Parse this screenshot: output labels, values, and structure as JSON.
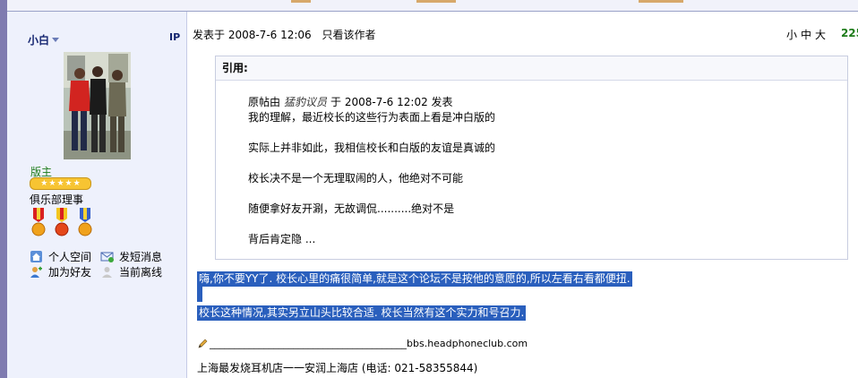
{
  "sidebar": {
    "username": "小白",
    "ip_label": "IP",
    "rank": "版主",
    "title": "俱乐部理事",
    "links": [
      {
        "label": "个人空间",
        "icon": "home-icon"
      },
      {
        "label": "发短消息",
        "icon": "message-icon"
      },
      {
        "label": "加为好友",
        "icon": "add-friend-icon"
      },
      {
        "label": "当前离线",
        "icon": "offline-user-icon"
      }
    ]
  },
  "post": {
    "meta": "发表于  2008-7-6 12:06",
    "author_only": "只看该作者",
    "font_sizes": "小中大",
    "floor": "225"
  },
  "quote": {
    "header": "引用:",
    "byline_prefix": "原帖由",
    "byline_name": "猛豹议员",
    "byline_suffix": "于  2008-7-6 12:02 发表",
    "lines": [
      "我的理解，最近校长的这些行为表面上看是冲白版的",
      "实际上并非如此，我相信校长和白版的友谊是真诚的",
      "校长决不是一个无理取闹的人，他绝对不可能",
      "随便拿好友开涮，无故调侃..........绝对不是",
      "背后肯定隐  ..."
    ]
  },
  "reply": {
    "line1": "嗨,你不要YY了. 校长心里的痛很简单,就是这个论坛不是按他的意愿的,所以左看右看都便扭.",
    "line2": "校长这种情况,其实另立山头比较合适. 校长当然有这个实力和号召力."
  },
  "signature": {
    "dashes": "________________________________________",
    "site": "bbs.headphoneclub.com",
    "shop": "上海最发烧耳机店一一安润上海店 (电话: 021-58355844)"
  },
  "colors": {
    "selection": "#2a5fbd",
    "sidebar_bg": "#eef1fc",
    "floor_green": "#1e7c1a"
  }
}
